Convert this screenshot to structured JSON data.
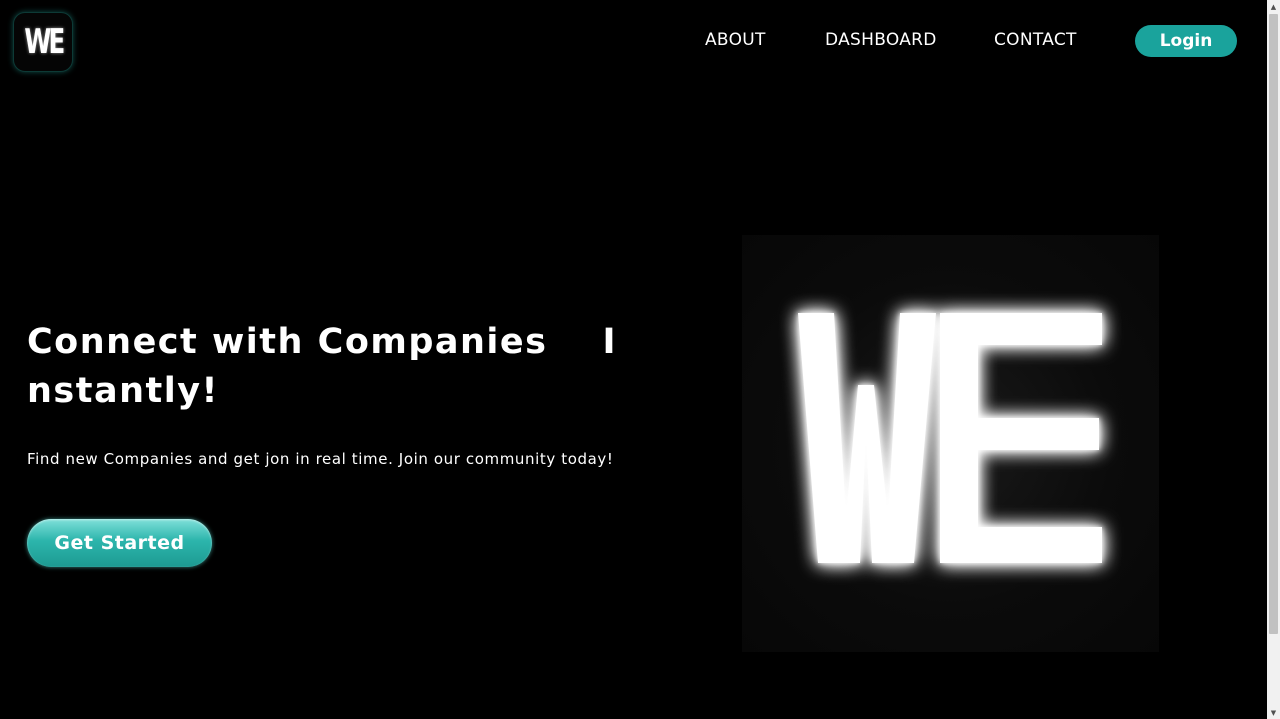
{
  "header": {
    "logo_text": "WE",
    "nav": {
      "about": "ABOUT",
      "dashboard": "DASHBOARD",
      "contact": "CONTACT"
    },
    "login_label": "Login"
  },
  "hero": {
    "title_part1": "Connect with Companies",
    "title_part2": "I",
    "title_part3": "nstantly!",
    "subtitle": "Find new Companies and get jon in real time. Join our community today!",
    "cta_label": "Get Started",
    "image_text": "WE"
  },
  "colors": {
    "background": "#000000",
    "accent": "#1aa39c",
    "text": "#ffffff"
  },
  "icons": {
    "scroll_up": "triangle-up-icon",
    "scroll_down": "triangle-down-icon"
  }
}
